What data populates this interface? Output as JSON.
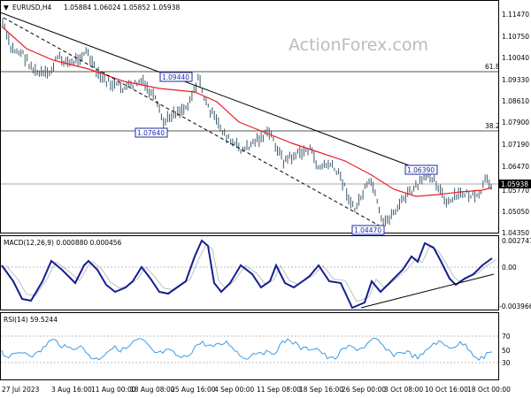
{
  "header": {
    "symbol": "EURUSD,H4",
    "ohlc": "1.05884 1.06024 1.05852 1.05938",
    "watermark": "ActionForex.com"
  },
  "price_panel": {
    "y_ticks": [
      "1.11470",
      "1.10750",
      "1.10040",
      "1.09330",
      "1.08610",
      "1.07900",
      "1.07190",
      "1.06470",
      "1.05770",
      "1.05050",
      "1.04350"
    ],
    "current_price": "1.05938",
    "fib_levels": [
      {
        "label": "61.8",
        "value": 1.096
      },
      {
        "label": "38.2",
        "value": 1.0775
      }
    ],
    "annotations": [
      {
        "label": "1.09440"
      },
      {
        "label": "1.07640"
      },
      {
        "label": "1.06390"
      },
      {
        "label": "1.04470"
      }
    ]
  },
  "macd_panel": {
    "title": "MACD(12,26,9) 0.000880 0.000456",
    "y_ticks": [
      "0.002747",
      "0.00",
      "-0.003966"
    ]
  },
  "rsi_panel": {
    "title": "RSI(14) 59.5244",
    "y_ticks": [
      "70",
      "50",
      "30"
    ]
  },
  "x_axis": {
    "labels": [
      "27 Jul 2023",
      "3 Aug 16:00",
      "11 Aug 00:00",
      "18 Aug 08:00",
      "25 Aug 16:00",
      "4 Sep 00:00",
      "11 Sep 08:00",
      "18 Sep 16:00",
      "26 Sep 00:00",
      "3 Oct 08:00",
      "10 Oct 16:00",
      "18 Oct 00:00"
    ]
  },
  "colors": {
    "price_bars": "#3d5a6b",
    "ma_line": "#e8202a",
    "trend_lines": "#000000",
    "macd_line": "#131f8f",
    "macd_signal": "#c0c0c0",
    "rsi_line": "#3b9be6",
    "label_border": "#1f2aa3"
  }
}
